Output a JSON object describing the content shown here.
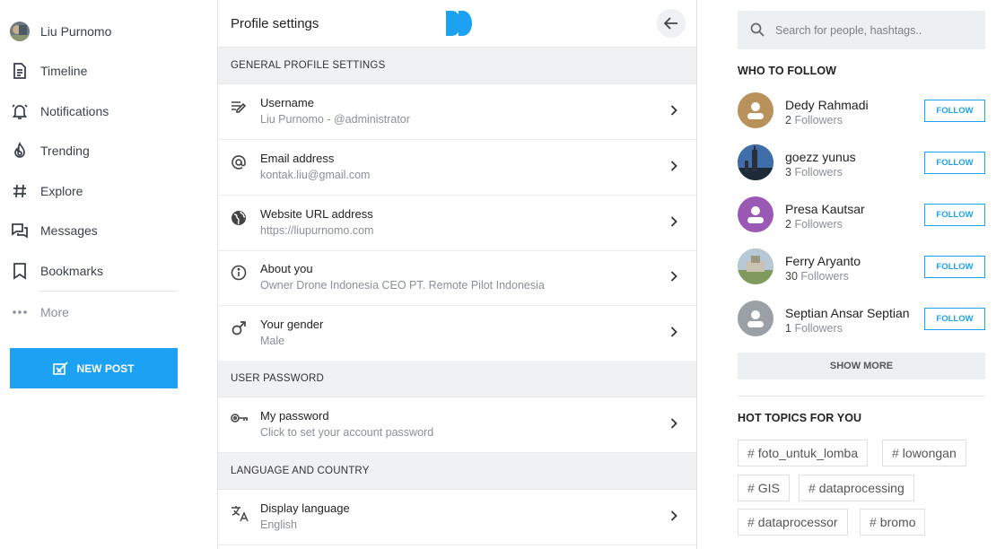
{
  "sidebar": {
    "user_name": "Liu Purnomo",
    "items": [
      {
        "label": "Timeline",
        "icon": "timeline-icon"
      },
      {
        "label": "Notifications",
        "icon": "bell-icon"
      },
      {
        "label": "Trending",
        "icon": "fire-icon"
      },
      {
        "label": "Explore",
        "icon": "hashtag-icon"
      },
      {
        "label": "Messages",
        "icon": "messages-icon"
      },
      {
        "label": "Bookmarks",
        "icon": "bookmark-icon"
      }
    ],
    "more_label": "More",
    "new_post_label": "NEW POST"
  },
  "header": {
    "title": "Profile settings"
  },
  "sections": {
    "general": "GENERAL PROFILE SETTINGS",
    "password": "USER PASSWORD",
    "language": "LANGUAGE AND COUNTRY"
  },
  "settings": {
    "username": {
      "label": "Username",
      "value": "Liu Purnomo - @administrator"
    },
    "email": {
      "label": "Email address",
      "value": "kontak.liu@gmail.com"
    },
    "website": {
      "label": "Website URL address",
      "value": "https://liupurnomo.com"
    },
    "about": {
      "label": "About you",
      "value": "Owner Drone Indonesia CEO PT. Remote Pilot Indonesia"
    },
    "gender": {
      "label": "Your gender",
      "value": "Male"
    },
    "password": {
      "label": "My password",
      "value": "Click to set your account password"
    },
    "language": {
      "label": "Display language",
      "value": "English"
    }
  },
  "search": {
    "placeholder": "Search for people, hashtags.."
  },
  "who_to_follow": {
    "title": "WHO TO FOLLOW",
    "button_label": "FOLLOW",
    "followers_suffix": "Followers",
    "users": [
      {
        "name": "Dedy Rahmadi",
        "followers": "2",
        "avatar_color": "#b8925a"
      },
      {
        "name": "goezz yunus",
        "followers": "3",
        "avatar_color": "#2c3e55"
      },
      {
        "name": "Presa Kautsar",
        "followers": "2",
        "avatar_color": "#9b59b6"
      },
      {
        "name": "Ferry Aryanto",
        "followers": "30",
        "avatar_color": "#8aa070"
      },
      {
        "name": "Septian Ansar Septian",
        "followers": "1",
        "avatar_color": "#9aa0a6"
      }
    ],
    "show_more_label": "SHOW MORE"
  },
  "hot_topics": {
    "title": "HOT TOPICS FOR YOU",
    "tags": [
      "foto_untuk_lomba",
      "lowongan",
      "GIS",
      "dataprocessing",
      "dataprocessor",
      "bromo"
    ]
  },
  "colors": {
    "accent": "#1da1f2"
  }
}
